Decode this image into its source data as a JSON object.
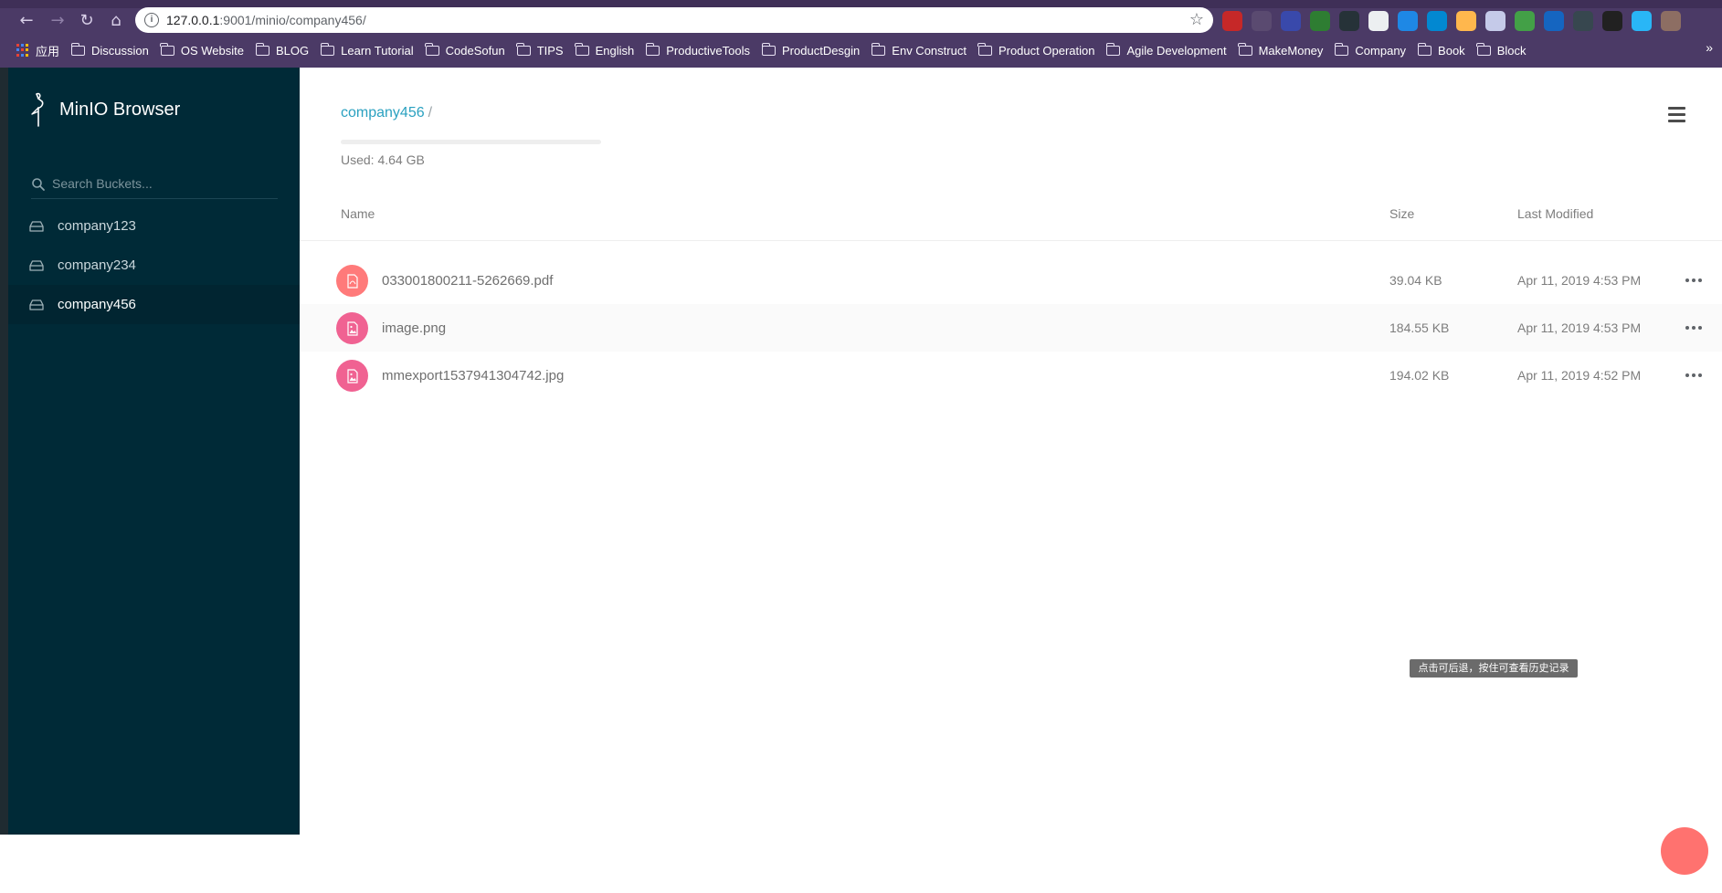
{
  "browser": {
    "url_host": "127.0.0.1",
    "url_path": ":9001/minio/company456/",
    "bookmarks": [
      {
        "label": "应用",
        "type": "apps"
      },
      {
        "label": "Discussion",
        "type": "folder"
      },
      {
        "label": "OS Website",
        "type": "folder"
      },
      {
        "label": "BLOG",
        "type": "folder"
      },
      {
        "label": "Learn Tutorial",
        "type": "folder"
      },
      {
        "label": "CodeSofun",
        "type": "folder"
      },
      {
        "label": "TIPS",
        "type": "folder"
      },
      {
        "label": "English",
        "type": "folder"
      },
      {
        "label": "ProductiveTools",
        "type": "folder"
      },
      {
        "label": "ProductDesgin",
        "type": "folder"
      },
      {
        "label": "Env Construct",
        "type": "folder"
      },
      {
        "label": "Product Operation",
        "type": "folder"
      },
      {
        "label": "Agile Development",
        "type": "folder"
      },
      {
        "label": "MakeMoney",
        "type": "folder"
      },
      {
        "label": "Company",
        "type": "folder"
      },
      {
        "label": "Book",
        "type": "folder"
      },
      {
        "label": "Block",
        "type": "folder"
      }
    ],
    "more_label": "»",
    "extension_colors": [
      "#c62828",
      "#5a4a70",
      "#3949ab",
      "#2e7d32",
      "#263238",
      "#eceff1",
      "#1e88e5",
      "#0288d1",
      "#ffb74d",
      "#c5cae9",
      "#43a047",
      "#1565c0",
      "#37474f",
      "#212121",
      "#29b6f6",
      "#8d6e63"
    ]
  },
  "sidebar": {
    "brand": "MinIO Browser",
    "search_placeholder": "Search Buckets...",
    "buckets": [
      {
        "label": "company123",
        "active": false
      },
      {
        "label": "company234",
        "active": false
      },
      {
        "label": "company456",
        "active": true
      }
    ]
  },
  "main": {
    "breadcrumb": {
      "bucket": "company456",
      "separator": "/"
    },
    "usage": {
      "text": "Used: 4.64 GB"
    },
    "columns": {
      "name": "Name",
      "size": "Size",
      "modified": "Last Modified"
    },
    "files": [
      {
        "name": "033001800211-5262669.pdf",
        "size": "39.04 KB",
        "modified": "Apr 11, 2019 4:53 PM",
        "icon": "pdf-file-icon"
      },
      {
        "name": "image.png",
        "size": "184.55 KB",
        "modified": "Apr 11, 2019 4:53 PM",
        "icon": "image-file-icon"
      },
      {
        "name": "mmexport1537941304742.jpg",
        "size": "194.02 KB",
        "modified": "Apr 11, 2019 4:52 PM",
        "icon": "image-file-icon"
      }
    ],
    "tooltip": "点击可后退，按住可查看历史记录"
  },
  "colors": {
    "sidebar_bg": "#002a37",
    "accent": "#2aa1c0",
    "pdf_icon": "#ff7a7a",
    "image_icon": "#f06292",
    "fab": "#ff726f"
  }
}
